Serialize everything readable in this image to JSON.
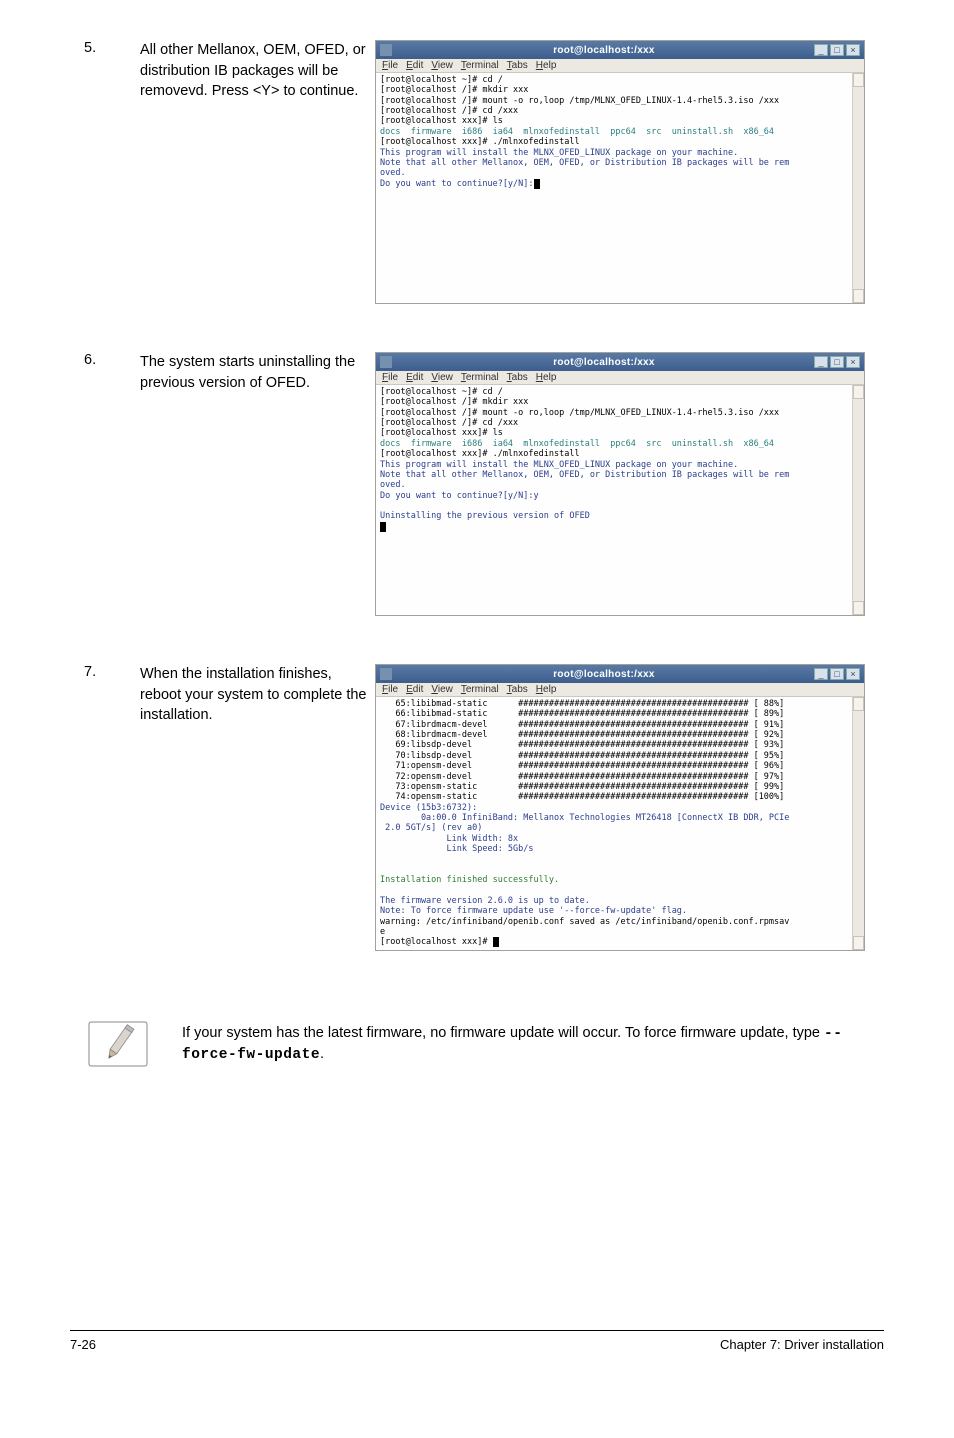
{
  "steps": [
    {
      "num": "5.",
      "text": "All other Mellanox, OEM, OFED, or distribution IB packages will be removevd. Press <Y> to continue."
    },
    {
      "num": "6.",
      "text": "The system starts uninstalling the previous version of OFED."
    },
    {
      "num": "7.",
      "text": "When the installation finishes, reboot your system to complete the installation."
    }
  ],
  "terminal": {
    "title": "root@localhost:/xxx",
    "menu": [
      "File",
      "Edit",
      "View",
      "Terminal",
      "Tabs",
      "Help"
    ],
    "win_min": "_",
    "win_max": "□",
    "win_close": "×"
  },
  "term5": {
    "l1": "[root@localhost ~]# cd /",
    "l2": "[root@localhost /]# mkdir xxx",
    "l3": "[root@localhost /]# mount -o ro,loop /tmp/MLNX_OFED_LINUX-1.4-rhel5.3.iso /xxx",
    "l4": "[root@localhost /]# cd /xxx",
    "l5": "[root@localhost xxx]# ls",
    "l6": "docs  firmware  i686  ia64  mlnxofedinstall  ppc64  src  uninstall.sh  x86_64",
    "l7": "[root@localhost xxx]# ./mlnxofedinstall",
    "l8": "This program will install the MLNX_OFED_LINUX package on your machine.",
    "l9": "Note that all other Mellanox, OEM, OFED, or Distribution IB packages will be rem",
    "l10": "oved.",
    "l11": "Do you want to continue?[y/N]:"
  },
  "term6": {
    "l1": "[root@localhost ~]# cd /",
    "l2": "[root@localhost /]# mkdir xxx",
    "l3": "[root@localhost /]# mount -o ro,loop /tmp/MLNX_OFED_LINUX-1.4-rhel5.3.iso /xxx",
    "l4": "[root@localhost /]# cd /xxx",
    "l5": "[root@localhost xxx]# ls",
    "l6": "docs  firmware  i686  ia64  mlnxofedinstall  ppc64  src  uninstall.sh  x86_64",
    "l7": "[root@localhost xxx]# ./mlnxofedinstall",
    "l8": "This program will install the MLNX_OFED_LINUX package on your machine.",
    "l9": "Note that all other Mellanox, OEM, OFED, or Distribution IB packages will be rem",
    "l10": "oved.",
    "l11": "Do you want to continue?[y/N]:y",
    "l12": "",
    "l13": "Uninstalling the previous version of OFED"
  },
  "term7": {
    "r0": "   65:libibmad-static      ############################################# [ 88%]",
    "r1": "   66:libibmad-static      ############################################# [ 89%]",
    "r2": "   67:librdmacm-devel      ############################################# [ 91%]",
    "r3": "   68:librdmacm-devel      ############################################# [ 92%]",
    "r4": "   69:libsdp-devel         ############################################# [ 93%]",
    "r5": "   70:libsdp-devel         ############################################# [ 95%]",
    "r6": "   71:opensm-devel         ############################################# [ 96%]",
    "r7": "   72:opensm-devel         ############################################# [ 97%]",
    "r8": "   73:opensm-static        ############################################# [ 99%]",
    "r9": "   74:opensm-static        ############################################# [100%]",
    "l10": "Device (15b3:6732):",
    "l11": "        0a:00.0 InfiniBand: Mellanox Technologies MT26418 [ConnectX IB DDR, PCIe",
    "l12": " 2.0 5GT/s] (rev a0)",
    "l13": "             Link Width: 8x",
    "l14": "             Link Speed: 5Gb/s",
    "l15": "",
    "l16": "",
    "l17": "Installation finished successfully.",
    "l18": "",
    "l19": "The firmware version 2.6.0 is up to date.",
    "l20": "Note: To force firmware update use '--force-fw-update' flag.",
    "l21": "warning: /etc/infiniband/openib.conf saved as /etc/infiniband/openib.conf.rpmsav",
    "l22": "e",
    "l23": "[root@localhost xxx]# "
  },
  "note": {
    "text_a": "If your system has the latest firmware, no firmware update will occur. To force firmware update, type ",
    "code": "--force-fw-update",
    "text_b": "."
  },
  "footer": {
    "left": "7-26",
    "right": "Chapter 7: Driver installation"
  }
}
